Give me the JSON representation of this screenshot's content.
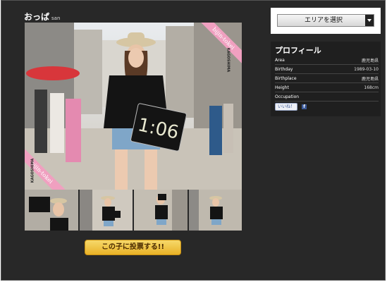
{
  "header": {
    "name": "おっぱ",
    "suffix": "san"
  },
  "photo": {
    "banner_text": "bijin-tokei",
    "corner_text": "KAGOSHIMA",
    "clock_display": "1:06"
  },
  "vote": {
    "label": "この子に投票する!!"
  },
  "area_select": {
    "label": "エリアを選択"
  },
  "profile": {
    "title": "プロフィール",
    "rows": [
      {
        "label": "Area",
        "value": "鹿児島県"
      },
      {
        "label": "Birthday",
        "value": "1989-03-10"
      },
      {
        "label": "Birthplace",
        "value": "鹿児島県"
      },
      {
        "label": "Height",
        "value": "168cm"
      },
      {
        "label": "Occupation",
        "value": ""
      }
    ],
    "like_label": "いいね！",
    "fb_letter": "f"
  },
  "colors": {
    "background": "#282828",
    "banner": "#f0a0c0",
    "button": "#e9b227",
    "facebook": "#3b5998"
  }
}
